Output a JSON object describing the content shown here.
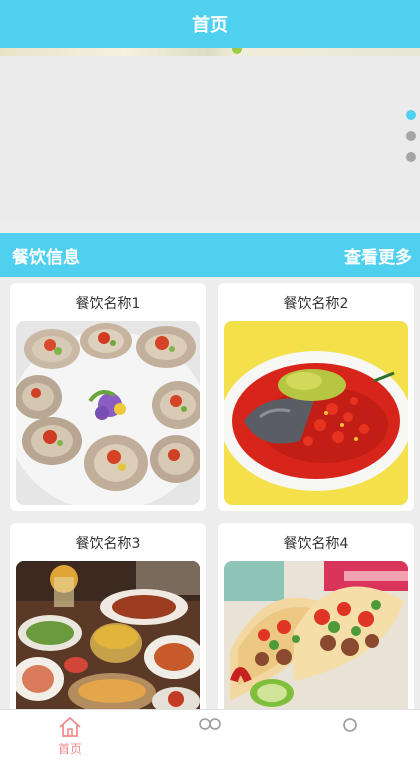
{
  "header": {
    "title": "首页"
  },
  "banner": {
    "slide_count": 3,
    "active_index": 0
  },
  "section": {
    "title": "餐饮信息",
    "more_label": "查看更多"
  },
  "cards": [
    {
      "title": "餐饮名称1",
      "image": "oysters"
    },
    {
      "title": "餐饮名称2",
      "image": "chili-fish-head"
    },
    {
      "title": "餐饮名称3",
      "image": "hotpot-spread"
    },
    {
      "title": "餐饮名称4",
      "image": "tacos"
    }
  ],
  "tabbar": {
    "items": [
      {
        "label": "首页",
        "icon": "home-icon",
        "active": true
      },
      {
        "label": "",
        "icon": "chat-icon",
        "active": false
      },
      {
        "label": "",
        "icon": "user-icon",
        "active": false
      }
    ]
  },
  "colors": {
    "accent": "#4fd0ee",
    "active_tab": "#f28c8c",
    "background": "#ededed"
  }
}
